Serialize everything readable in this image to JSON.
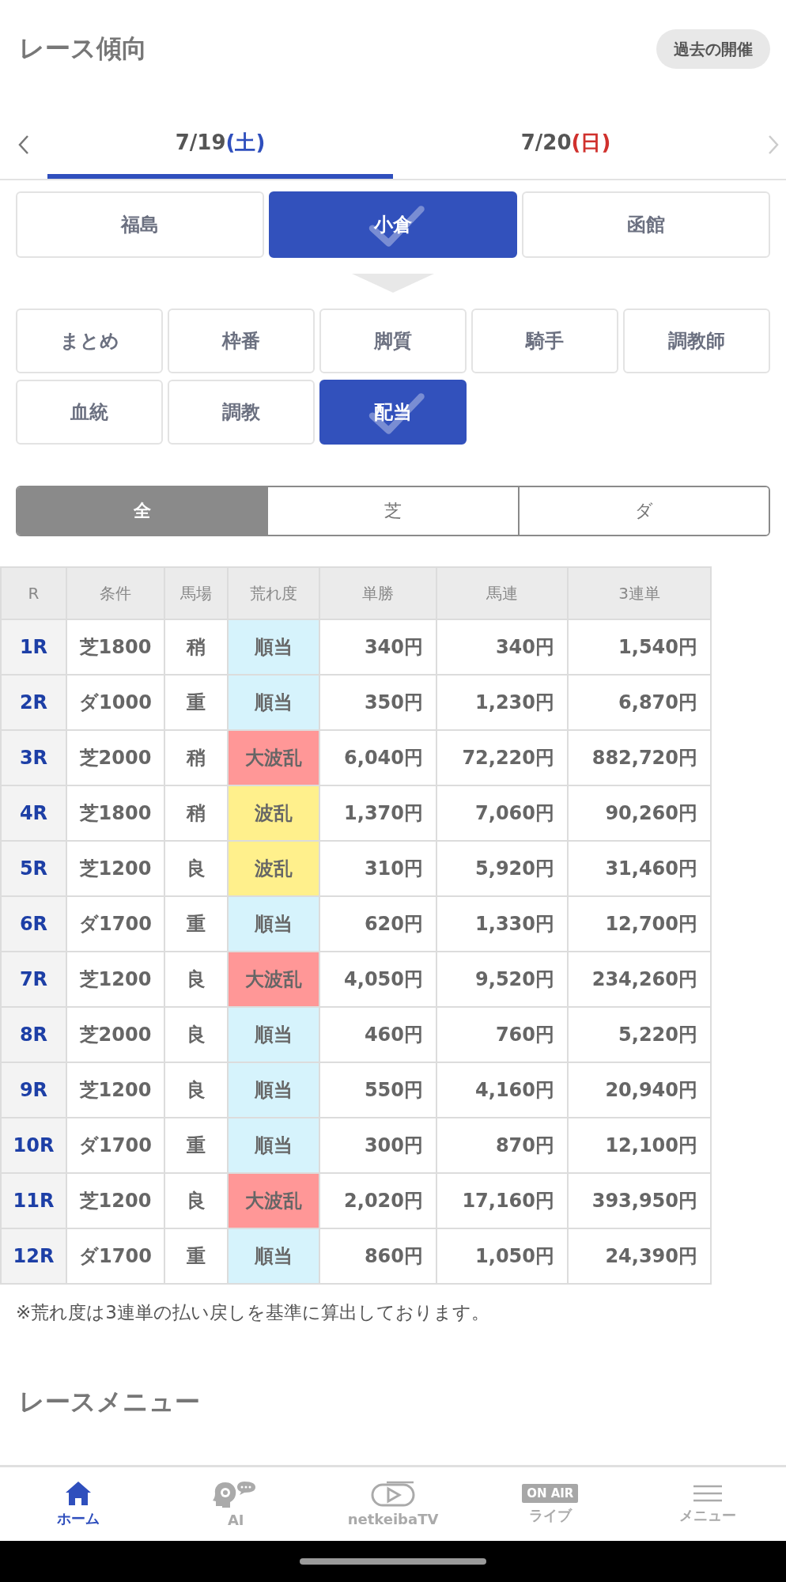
{
  "header": {
    "title": "レース傾向",
    "past_button": "過去の開催"
  },
  "date_tabs": [
    {
      "date": "7/19",
      "weekday": "(土)",
      "color": "#2f4fbd",
      "selected": true
    },
    {
      "date": "7/20",
      "weekday": "(日)",
      "color": "#d0312d",
      "selected": false
    }
  ],
  "venues": [
    {
      "label": "福島",
      "selected": false
    },
    {
      "label": "小倉",
      "selected": true
    },
    {
      "label": "函館",
      "selected": false
    }
  ],
  "categories": [
    {
      "label": "まとめ",
      "selected": false
    },
    {
      "label": "枠番",
      "selected": false
    },
    {
      "label": "脚質",
      "selected": false
    },
    {
      "label": "騎手",
      "selected": false
    },
    {
      "label": "調教師",
      "selected": false
    },
    {
      "label": "血統",
      "selected": false
    },
    {
      "label": "調教",
      "selected": false
    },
    {
      "label": "配当",
      "selected": true
    }
  ],
  "surface_filter": [
    {
      "label": "全",
      "selected": true
    },
    {
      "label": "芝",
      "selected": false
    },
    {
      "label": "ダ",
      "selected": false
    }
  ],
  "table": {
    "columns": [
      "R",
      "条件",
      "馬場",
      "荒れ度",
      "単勝",
      "馬連",
      "3連単"
    ],
    "rows": [
      {
        "race": "1R",
        "condition": "芝1800",
        "going": "稍",
        "roughness": "順当",
        "color": "#d6f3fc",
        "win": "340円",
        "quinella": "340円",
        "trifecta": "1,540円"
      },
      {
        "race": "2R",
        "condition": "ダ1000",
        "going": "重",
        "roughness": "順当",
        "color": "#d6f3fc",
        "win": "350円",
        "quinella": "1,230円",
        "trifecta": "6,870円"
      },
      {
        "race": "3R",
        "condition": "芝2000",
        "going": "稍",
        "roughness": "大波乱",
        "color": "#ff9797",
        "win": "6,040円",
        "quinella": "72,220円",
        "trifecta": "882,720円"
      },
      {
        "race": "4R",
        "condition": "芝1800",
        "going": "稍",
        "roughness": "波乱",
        "color": "#fff08c",
        "win": "1,370円",
        "quinella": "7,060円",
        "trifecta": "90,260円"
      },
      {
        "race": "5R",
        "condition": "芝1200",
        "going": "良",
        "roughness": "波乱",
        "color": "#fff08c",
        "win": "310円",
        "quinella": "5,920円",
        "trifecta": "31,460円"
      },
      {
        "race": "6R",
        "condition": "ダ1700",
        "going": "重",
        "roughness": "順当",
        "color": "#d6f3fc",
        "win": "620円",
        "quinella": "1,330円",
        "trifecta": "12,700円"
      },
      {
        "race": "7R",
        "condition": "芝1200",
        "going": "良",
        "roughness": "大波乱",
        "color": "#ff9797",
        "win": "4,050円",
        "quinella": "9,520円",
        "trifecta": "234,260円"
      },
      {
        "race": "8R",
        "condition": "芝2000",
        "going": "良",
        "roughness": "順当",
        "color": "#d6f3fc",
        "win": "460円",
        "quinella": "760円",
        "trifecta": "5,220円"
      },
      {
        "race": "9R",
        "condition": "芝1200",
        "going": "良",
        "roughness": "順当",
        "color": "#d6f3fc",
        "win": "550円",
        "quinella": "4,160円",
        "trifecta": "20,940円"
      },
      {
        "race": "10R",
        "condition": "ダ1700",
        "going": "重",
        "roughness": "順当",
        "color": "#d6f3fc",
        "win": "300円",
        "quinella": "870円",
        "trifecta": "12,100円"
      },
      {
        "race": "11R",
        "condition": "芝1200",
        "going": "良",
        "roughness": "大波乱",
        "color": "#ff9797",
        "win": "2,020円",
        "quinella": "17,160円",
        "trifecta": "393,950円"
      },
      {
        "race": "12R",
        "condition": "ダ1700",
        "going": "重",
        "roughness": "順当",
        "color": "#d6f3fc",
        "win": "860円",
        "quinella": "1,050円",
        "trifecta": "24,390円"
      }
    ]
  },
  "note": "※荒れ度は3連単の払い戻しを基準に算出しております。",
  "section_title": "レースメニュー",
  "bottom_nav": [
    {
      "kind": "home",
      "label": "ホーム",
      "selected": true
    },
    {
      "kind": "ai",
      "label": "AI",
      "selected": false
    },
    {
      "kind": "tv",
      "label": "netkeibaTV",
      "selected": false
    },
    {
      "kind": "live",
      "label": "ライブ",
      "badge": "ON AIR",
      "selected": false
    },
    {
      "kind": "menu",
      "label": "メニュー",
      "selected": false
    }
  ]
}
